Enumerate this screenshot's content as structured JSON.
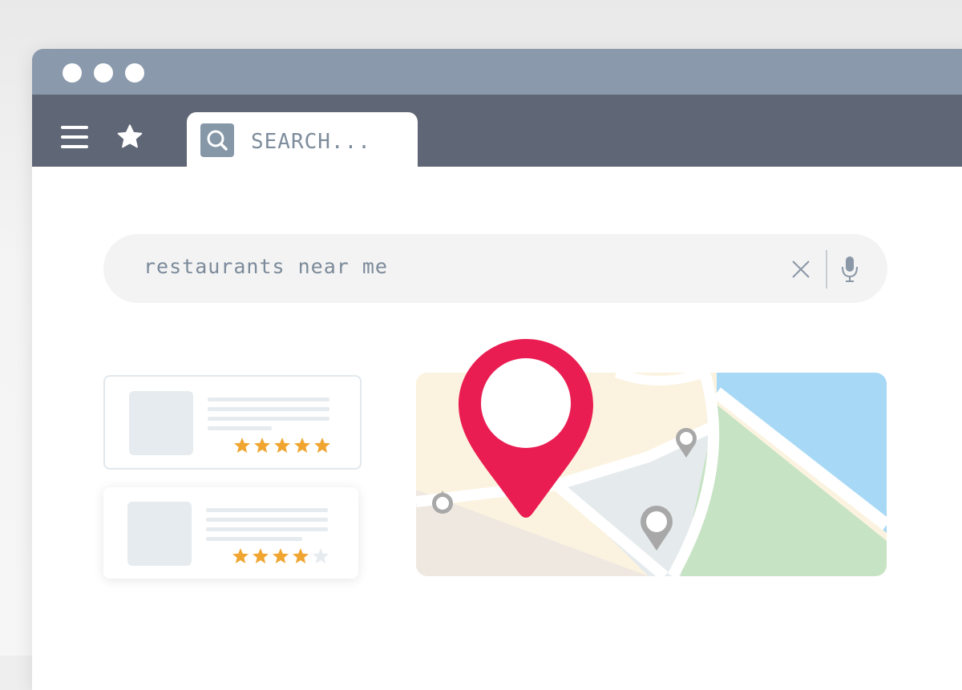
{
  "browser": {
    "tab": {
      "label": "SEARCH...",
      "search_icon": "search-icon"
    },
    "toolbar": {
      "menu_icon": "hamburger-menu-icon",
      "bookmark_icon": "star-icon"
    }
  },
  "search": {
    "query": "restaurants near me",
    "clear_icon": "close-icon",
    "voice_icon": "microphone-icon"
  },
  "results": [
    {
      "rating": 5,
      "max_rating": 5
    },
    {
      "rating": 4,
      "max_rating": 5
    }
  ],
  "map": {
    "main_pin_icon": "map-pin-icon",
    "small_pins": 3
  },
  "colors": {
    "titlebar": "#8a99ac",
    "toolbar": "#5f6675",
    "star_filled": "#f0a531",
    "star_empty": "#e6ebef",
    "main_pin": "#ea1d52",
    "map_water": "#a7d9f6",
    "map_park": "#c6e3c3"
  }
}
